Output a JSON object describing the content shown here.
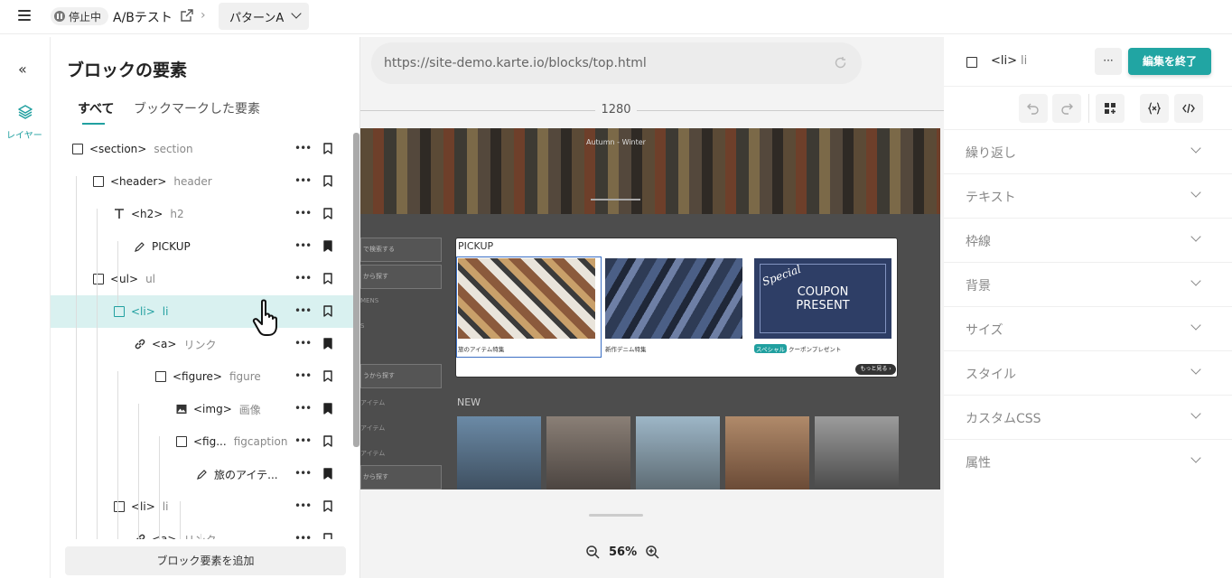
{
  "topbar": {
    "status": "停止中",
    "test_name": "A/Bテスト",
    "pattern": "パターンA"
  },
  "rail": {
    "layer_label": "レイヤー"
  },
  "panel": {
    "title": "ブロックの要素",
    "tabs": [
      {
        "label": "すべて",
        "active": true
      },
      {
        "label": "ブックマークした要素",
        "active": false
      }
    ],
    "tree": [
      {
        "icon": "square-icon",
        "tag": "<section>",
        "name": "section",
        "bookmarked": false
      },
      {
        "icon": "square-icon",
        "tag": "<header>",
        "name": "header",
        "bookmarked": false
      },
      {
        "icon": "text-icon",
        "tag": "<h2>",
        "name": "h2",
        "bookmarked": false
      },
      {
        "icon": "pencil-icon",
        "tag": "PICKUP",
        "name": "",
        "bookmarked": true
      },
      {
        "icon": "square-icon",
        "tag": "<ul>",
        "name": "ul",
        "bookmarked": false
      },
      {
        "icon": "square-icon",
        "tag": "<li>",
        "name": "li",
        "bookmarked": false,
        "selected": true
      },
      {
        "icon": "link-icon",
        "tag": "<a>",
        "name": "リンク",
        "bookmarked": true
      },
      {
        "icon": "square-icon",
        "tag": "<figure>",
        "name": "figure",
        "bookmarked": false
      },
      {
        "icon": "image-icon",
        "tag": "<img>",
        "name": "画像",
        "bookmarked": true
      },
      {
        "icon": "square-icon",
        "tag": "<fig...",
        "name": "figcaption",
        "bookmarked": false
      },
      {
        "icon": "pencil-icon",
        "tag": "旅のアイテ...",
        "name": "",
        "bookmarked": true
      },
      {
        "icon": "square-icon",
        "tag": "<li>",
        "name": "li",
        "bookmarked": false
      },
      {
        "icon": "link-icon",
        "tag": "<a>",
        "name": "リンク",
        "bookmarked": false
      }
    ],
    "add_button": "ブロック要素を追加"
  },
  "canvas": {
    "url": "https://site-demo.karte.io/blocks/top.html",
    "ruler": "1280",
    "zoom": "56%",
    "preview": {
      "hero_text": "Autumn - Winter",
      "side_items": [
        "で検索する",
        "から探す",
        "MENS",
        "S",
        "",
        "うから探す",
        "アイテム",
        "アイテム",
        "アイテム",
        "から探す"
      ],
      "pickup_label": "PICKUP",
      "cards": [
        {
          "caption": "旅のアイテム特集",
          "badge": ""
        },
        {
          "caption": "新作デニム特集",
          "badge": ""
        },
        {
          "caption": "クーポンプレゼント",
          "badge": "スペシャル"
        }
      ],
      "coupon": {
        "special": "Special",
        "line1": "COUPON",
        "line2": "PRESENT"
      },
      "more": "もっと見る ›",
      "new_label": "NEW"
    }
  },
  "right": {
    "tag": "<li>",
    "name": "li",
    "more": "···",
    "finish": "編集を終了",
    "sections": [
      "繰り返し",
      "テキスト",
      "枠線",
      "背景",
      "サイズ",
      "スタイル",
      "カスタムCSS",
      "属性"
    ]
  },
  "colors": {
    "accent": "#21a5a3",
    "selected_row": "#d9f1f0"
  }
}
